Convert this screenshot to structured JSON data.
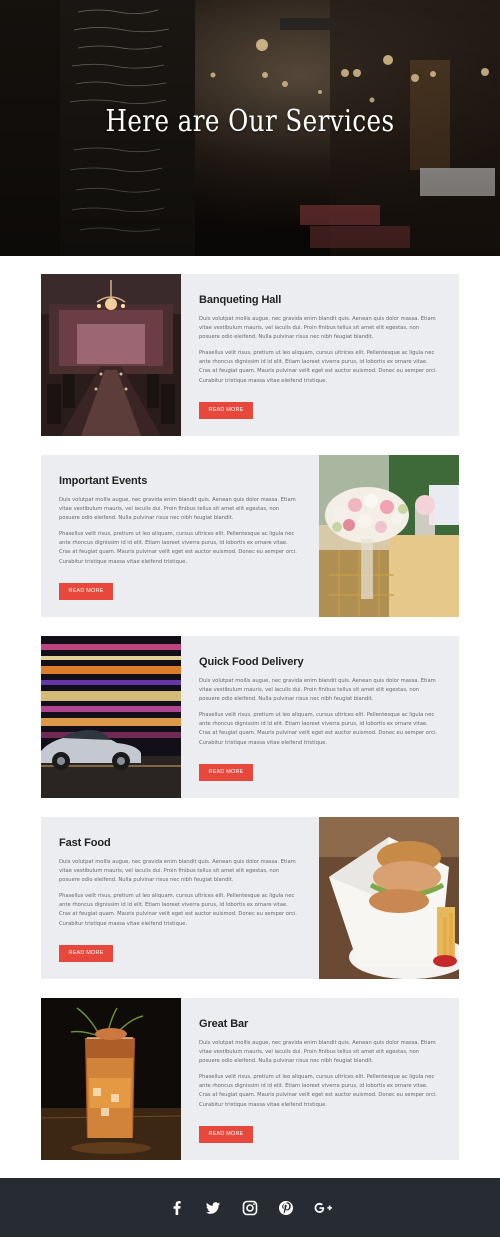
{
  "hero": {
    "title": "Here are Our Services"
  },
  "services": [
    {
      "title": "Banqueting Hall",
      "p1": "Duis volutpat mollis augue, nec gravida enim blandit quis. Aenean quis dolor massa. Etiam vitae vestibulum mauris, vel iaculis dui. Proin finibus tellus sit amet elit egestas, non posuere odio eleifend. Nulla pulvinar risus nec nibh feugiat blandit.",
      "p2": "Phasellus velit risus, pretium ut leo aliquam, cursus ultrices elit. Pellentesque ac ligula nec ante rhoncus dignissim id id elit. Etiam laoreet viverra purus, id lobortis ex ornare vitae. Cras at feugiat quam. Mauris pulvinar velit eget est auctor euismod. Donec eu semper orci. Curabitur tristique massa vitae eleifend tristique.",
      "button": "READ MORE",
      "image": "banquet-hall-photo"
    },
    {
      "title": "Important Events",
      "p1": "Duis volutpat mollis augue, nec gravida enim blandit quis. Aenean quis dolor massa. Etiam vitae vestibulum mauris, vel iaculis dui. Proin finibus tellus sit amet elit egestas, non posuere odio eleifend. Nulla pulvinar risus nec nibh feugiat blandit.",
      "p2": "Phasellus velit risus, pretium ut leo aliquam, cursus ultrices elit. Pellentesque ac ligula nec ante rhoncus dignissim id id elit. Etiam laoreet viverra purus, id lobortis ex ornare vitae. Cras at feugiat quam. Mauris pulvinar velit eget est auctor euismod. Donec eu semper orci. Curabitur tristique massa vitae eleifend tristique.",
      "button": "READ MORE",
      "image": "flower-bouquet-photo"
    },
    {
      "title": "Quick Food Delivery",
      "p1": "Duis volutpat mollis augue, nec gravida enim blandit quis. Aenean quis dolor massa. Etiam vitae vestibulum mauris, vel iaculis dui. Proin finibus tellus sit amet elit egestas, non posuere odio eleifend. Nulla pulvinar risus nec nibh feugiat blandit.",
      "p2": "Phasellus velit risus, pretium ut leo aliquam, cursus ultrices elit. Pellentesque ac ligula nec ante rhoncus dignissim id id elit. Etiam laoreet viverra purus, id lobortis ex ornare vitae. Cras at feugiat quam. Mauris pulvinar velit eget est auctor euismod. Donec eu semper orci. Curabitur tristique massa vitae eleifend tristique.",
      "button": "READ MORE",
      "image": "speeding-car-photo"
    },
    {
      "title": "Fast Food",
      "p1": "Duis volutpat mollis augue, nec gravida enim blandit quis. Aenean quis dolor massa. Etiam vitae vestibulum mauris, vel iaculis dui. Proin finibus tellus sit amet elit egestas, non posuere odio eleifend. Nulla pulvinar risus nec nibh feugiat blandit.",
      "p2": "Phasellus velit risus, pretium ut leo aliquam, cursus ultrices elit. Pellentesque ac ligula nec ante rhoncus dignissim id id elit. Etiam laoreet viverra purus, id lobortis ex ornare vitae. Cras at feugiat quam. Mauris pulvinar velit eget est auctor euismod. Donec eu semper orci. Curabitur tristique massa vitae eleifend tristique.",
      "button": "READ MORE",
      "image": "burger-wrap-photo"
    },
    {
      "title": "Great Bar",
      "p1": "Duis volutpat mollis augue, nec gravida enim blandit quis. Aenean quis dolor massa. Etiam vitae vestibulum mauris, vel iaculis dui. Proin finibus tellus sit amet elit egestas, non posuere odio eleifend. Nulla pulvinar risus nec nibh feugiat blandit.",
      "p2": "Phasellus velit risus, pretium ut leo aliquam, cursus ultrices elit. Pellentesque ac ligula nec ante rhoncus dignissim id id elit. Etiam laoreet viverra purus, id lobortis ex ornare vitae. Cras at feugiat quam. Mauris pulvinar velit eget est auctor euismod. Donec eu semper orci. Curabitur tristique massa vitae eleifend tristique.",
      "button": "READ MORE",
      "image": "cocktail-glass-photo"
    }
  ],
  "footer": {
    "social_icons": [
      "facebook-icon",
      "twitter-icon",
      "instagram-icon",
      "pinterest-icon",
      "google-plus-icon"
    ]
  },
  "colors": {
    "accent": "#e8473b",
    "card_bg": "#ebedf0",
    "footer_bg": "#272c32",
    "title": "#222222",
    "body_text": "#666666"
  }
}
